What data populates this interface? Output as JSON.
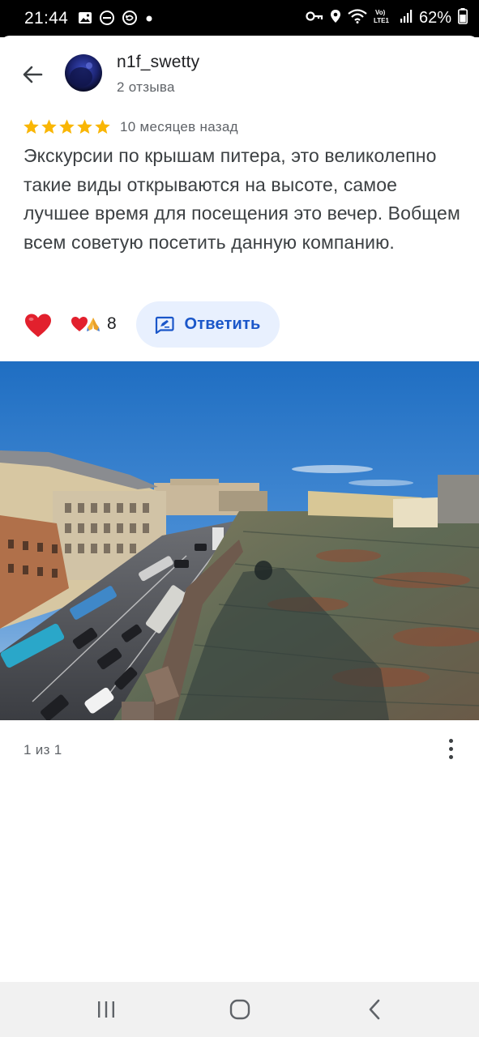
{
  "status_bar": {
    "time": "21:44",
    "battery_percent": "62%",
    "icons": [
      "gallery-icon",
      "dnd-icon",
      "sync-icon",
      "dot-icon",
      "vpn-key-icon",
      "location-icon",
      "wifi-icon",
      "volte-icon",
      "signal-icon",
      "battery-icon"
    ]
  },
  "header": {
    "back_icon": "arrow-left-icon",
    "username": "n1f_swetty",
    "review_count": "2 отзыва"
  },
  "review": {
    "rating": 5,
    "max_rating": 5,
    "date": "10 месяцев назад",
    "text": "Экскурсии по крышам питера, это великолепно такие виды открываются на высоте, самое лучшее время для посещения это вечер. Вобщем всем советую посетить данную компанию."
  },
  "actions": {
    "like_icon": "heart-icon",
    "reaction_icons": [
      "heart-emoji-icon",
      "praying-hands-icon"
    ],
    "reaction_count": "8",
    "reply_label": "Ответить",
    "reply_icon": "reply-icon"
  },
  "photo": {
    "description_icon": "photo-rooftop-icon",
    "counter": "1 из 1",
    "more_icon": "more-vert-icon"
  },
  "colors": {
    "star": "#f9b605",
    "heart": "#e2202d",
    "reply_bg": "#e8f0fe",
    "reply_text": "#1a56c9",
    "text_primary": "#202124",
    "text_secondary": "#5f6368"
  },
  "nav_bar": {
    "items": [
      "recents-icon",
      "home-icon",
      "back-icon"
    ]
  }
}
